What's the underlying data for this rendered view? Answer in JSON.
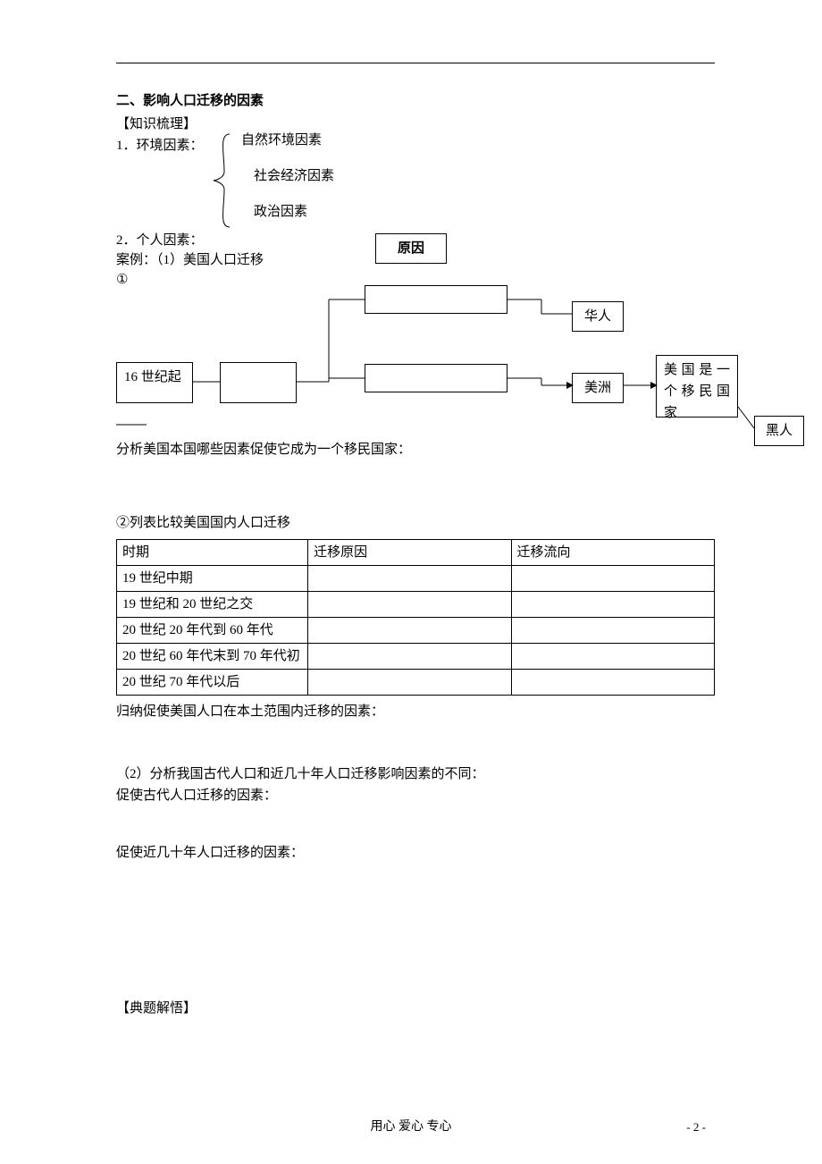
{
  "section2": {
    "title": "二、影响人口迁移的因素",
    "kb_label": "【知识梳理】",
    "env_label": "1．环境因素：",
    "env_items": [
      "自然环境因素",
      "社会经济因素",
      "政治因素"
    ],
    "personal": "2．个人因素：",
    "case_label": "案例：（1）美国人口迁移",
    "circled1": "①"
  },
  "diagram": {
    "reason": "原因",
    "century": "16 世纪起",
    "huaren": "华人",
    "meizhou": "美洲",
    "usa_immigrant": "美国是一个移民国家",
    "heiren": "黑人",
    "analyze": "分析美国本国哪些因素促使它成为一个移民国家："
  },
  "table_intro": "②列表比较美国国内人口迁移",
  "table": {
    "headers": [
      "时期",
      "迁移原因",
      "迁移流向"
    ],
    "rows": [
      [
        "19 世纪中期",
        "",
        ""
      ],
      [
        "19 世纪和 20 世纪之交",
        "",
        ""
      ],
      [
        "20 世纪 20 年代到 60 年代",
        "",
        ""
      ],
      [
        "20 世纪 60 年代末到 70 年代初",
        "",
        ""
      ],
      [
        "20 世纪 70 年代以后",
        "",
        ""
      ]
    ]
  },
  "after_table": {
    "summary": "归纳促使美国人口在本土范围内迁移的因素：",
    "q2": "（2）分析我国古代人口和近几十年人口迁移影响因素的不同：",
    "ancient": "促使古代人口迁移的因素：",
    "recent": "促使近几十年人口迁移的因素："
  },
  "exemplar": "【典题解悟】",
  "footer": {
    "motto": "用心    爱心    专心",
    "page": "- 2 -"
  }
}
